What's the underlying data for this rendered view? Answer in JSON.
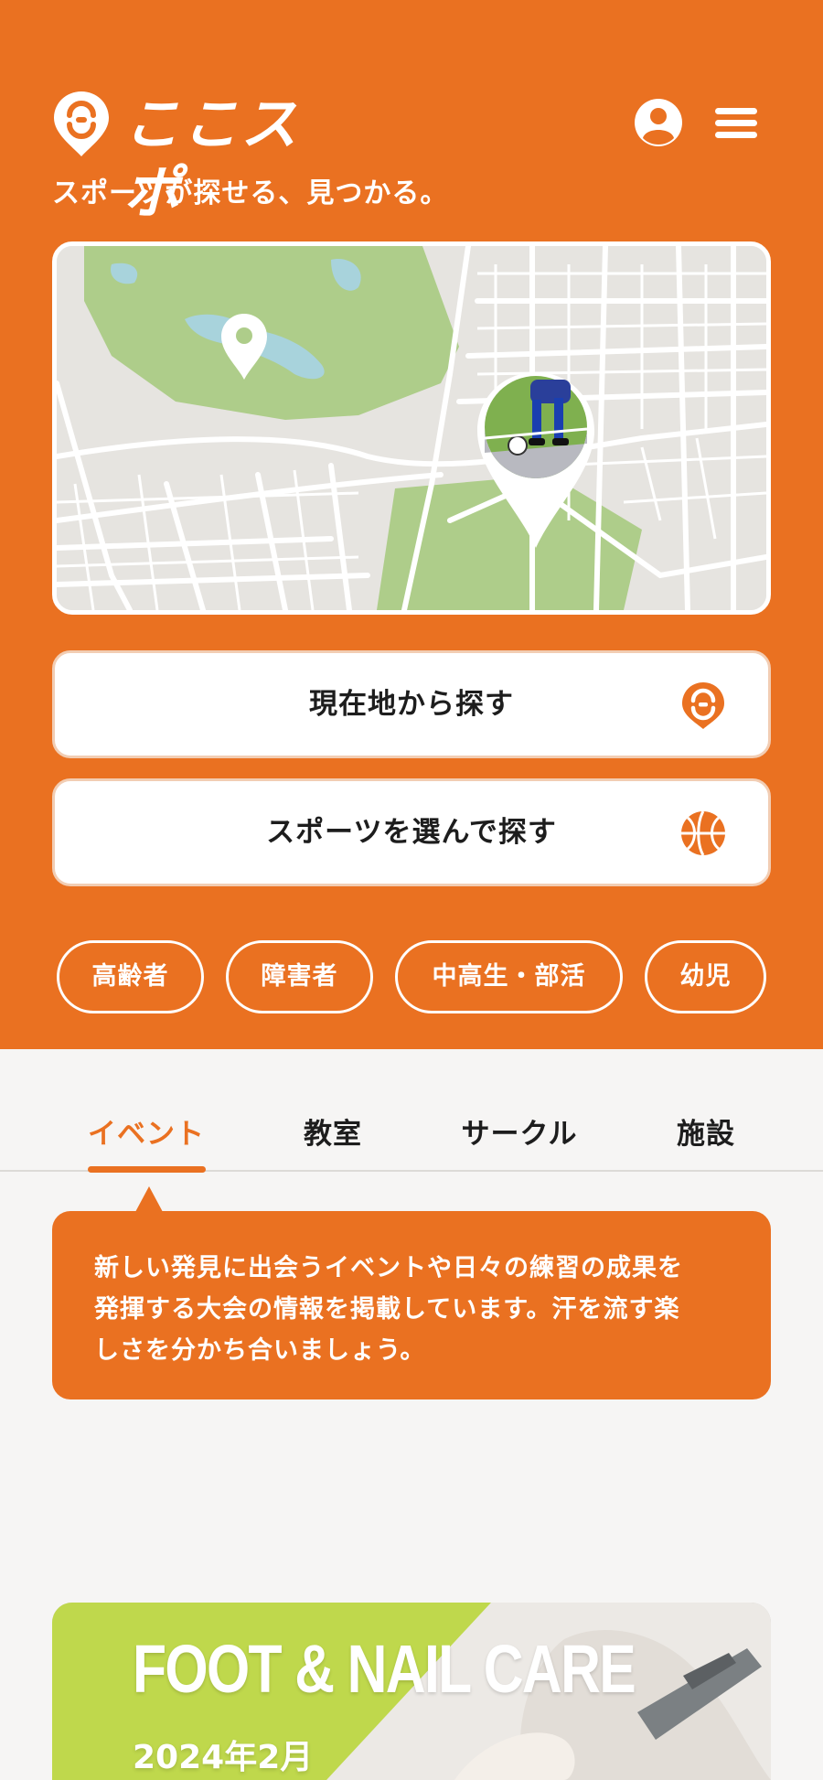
{
  "colors": {
    "brand": "#ea7121",
    "background": "#f6f5f4",
    "white": "#ffffff"
  },
  "header": {
    "logo_text": "ここスポ",
    "tagline": "スポーツが探せる、見つかる。",
    "icons": [
      "user-icon",
      "hamburger-menu-icon"
    ]
  },
  "map": {
    "icons": [
      "map-pin-icon",
      "soccer-photo-pin-icon"
    ]
  },
  "actions": [
    {
      "label": "現在地から探す",
      "icon": "location-icon"
    },
    {
      "label": "スポーツを選んで探す",
      "icon": "basketball-icon"
    }
  ],
  "filters": [
    "高齢者",
    "障害者",
    "中高生・部活",
    "幼児"
  ],
  "tabs": [
    {
      "label": "イベント",
      "active": true
    },
    {
      "label": "教室",
      "active": false
    },
    {
      "label": "サークル",
      "active": false
    },
    {
      "label": "施設",
      "active": false
    }
  ],
  "description": {
    "line1": "新しい発見に出会うイベントや日々の練習の成果を",
    "line2": "発揮する大会の情報を掲載しています。汗を流す楽",
    "line3": "しさを分かち合いましょう。"
  },
  "banner": {
    "title": "FOOT & NAIL CARE",
    "date": "2024年2月"
  }
}
